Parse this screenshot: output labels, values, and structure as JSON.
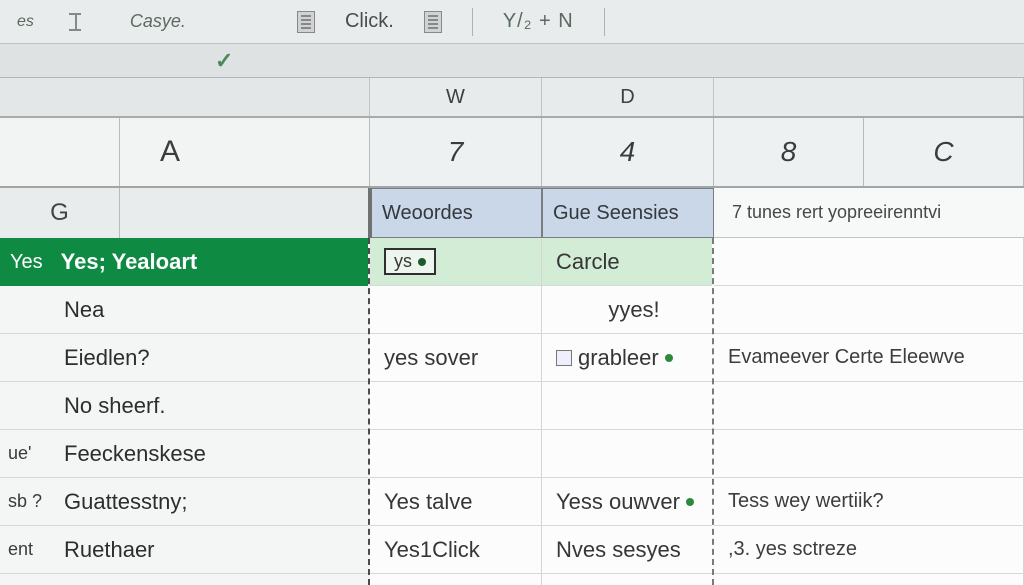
{
  "toolbar": {
    "tab1": "es",
    "tab2": "Casye.",
    "label_click": "Click.",
    "yn": "Y/₂ + N"
  },
  "upper_cols": {
    "w": "W",
    "d": "D"
  },
  "bighead": {
    "a": "A",
    "g": "G",
    "seven": "7",
    "four": "4",
    "eight": "8",
    "c": "C"
  },
  "rheaders": {
    "h1": "Weoordes",
    "h2": "Gue Seensies",
    "tail": "7   tunes rert  yopreeirenntvi"
  },
  "greenbar": {
    "yes": "Yes",
    "yealoat": "Yes; Yealoart"
  },
  "left_rows": [
    {
      "prefix": "",
      "txt": "Nea"
    },
    {
      "prefix": "",
      "txt": "Eiedlen?"
    },
    {
      "prefix": "",
      "txt": "No sheerf."
    },
    {
      "prefix": "ue'",
      "txt": "Feeckenskese"
    },
    {
      "prefix": "sb ?",
      "txt": "Guattesstny;"
    },
    {
      "prefix": "ent",
      "txt": "Ruethaer"
    }
  ],
  "colA": {
    "r0_sel": "ys",
    "r2": "yes sover",
    "r5": "Yes talve",
    "r6": "Yes1Click"
  },
  "colB": {
    "r0": "Carcle",
    "r1": "yyes!",
    "r2": "grableer",
    "r5": "Yess ouwver",
    "r6": "Nves sesyes"
  },
  "colC": {
    "r2": "Evameever Certe Eleewve",
    "r5": "Tess wey wertiik?",
    "r6": ",3. yes sctreze"
  }
}
